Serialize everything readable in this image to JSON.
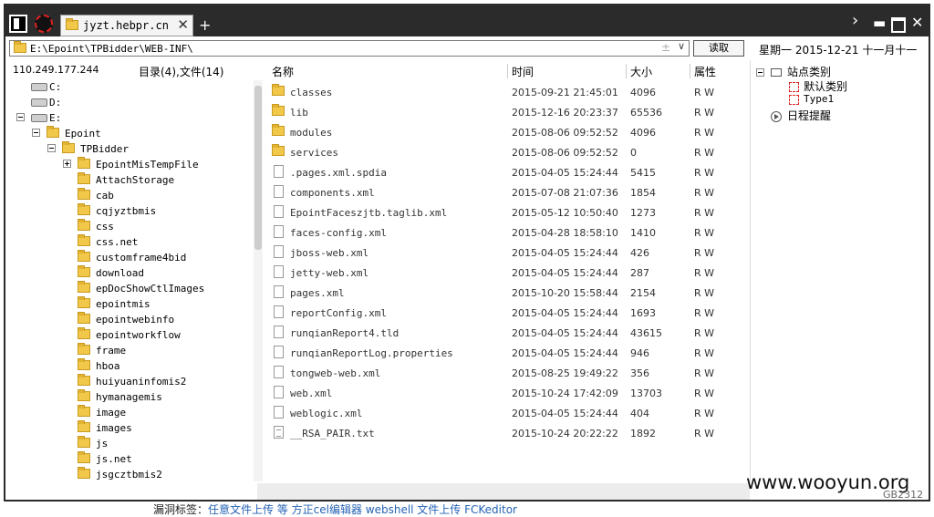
{
  "window": {
    "tab_title": "jyzt.hebpr.cn",
    "tab_close": "✕",
    "tab_add": "+",
    "nav_next": "›",
    "minimize": "▬",
    "close": "✕"
  },
  "address": {
    "path": "E:\\Epoint\\TPBidder\\WEB-INF\\",
    "clear": "±",
    "dropdown": "∨",
    "read_button": "读取"
  },
  "date_display": "星期一  2015-12-21  十一月十一",
  "left": {
    "ip": "110.249.177.244",
    "dir_count": "目录(4),文件(14)",
    "tree": [
      {
        "label": "C:",
        "type": "drive",
        "level": 0
      },
      {
        "label": "D:",
        "type": "drive",
        "level": 0
      },
      {
        "label": "E:",
        "type": "drive",
        "level": 0,
        "toggle": "minus"
      },
      {
        "label": "Epoint",
        "type": "folder",
        "level": 1,
        "toggle": "minus"
      },
      {
        "label": "TPBidder",
        "type": "folder",
        "level": 2,
        "toggle": "minus"
      },
      {
        "label": "EpointMisTempFile",
        "type": "folder",
        "level": 3,
        "toggle": "plus"
      },
      {
        "label": "AttachStorage",
        "type": "folder",
        "level": 3
      },
      {
        "label": "cab",
        "type": "folder",
        "level": 3
      },
      {
        "label": "cqjyztbmis",
        "type": "folder",
        "level": 3
      },
      {
        "label": "css",
        "type": "folder",
        "level": 3
      },
      {
        "label": "css.net",
        "type": "folder",
        "level": 3
      },
      {
        "label": "customframe4bid",
        "type": "folder",
        "level": 3
      },
      {
        "label": "download",
        "type": "folder",
        "level": 3
      },
      {
        "label": "epDocShowCtlImages",
        "type": "folder",
        "level": 3
      },
      {
        "label": "epointmis",
        "type": "folder",
        "level": 3
      },
      {
        "label": "epointwebinfo",
        "type": "folder",
        "level": 3
      },
      {
        "label": "epointworkflow",
        "type": "folder",
        "level": 3
      },
      {
        "label": "frame",
        "type": "folder",
        "level": 3
      },
      {
        "label": "hboa",
        "type": "folder",
        "level": 3
      },
      {
        "label": "huiyuaninfomis2",
        "type": "folder",
        "level": 3
      },
      {
        "label": "hymanagemis",
        "type": "folder",
        "level": 3
      },
      {
        "label": "image",
        "type": "folder",
        "level": 3
      },
      {
        "label": "images",
        "type": "folder",
        "level": 3
      },
      {
        "label": "js",
        "type": "folder",
        "level": 3
      },
      {
        "label": "js.net",
        "type": "folder",
        "level": 3
      },
      {
        "label": "jsgcztbmis2",
        "type": "folder",
        "level": 3
      }
    ]
  },
  "list": {
    "headers": {
      "name": "名称",
      "time": "时间",
      "size": "大小",
      "attr": "属性"
    },
    "rows": [
      {
        "name": "classes",
        "time": "2015-09-21 21:45:01",
        "size": "4096",
        "attr": "R W",
        "type": "folder"
      },
      {
        "name": "lib",
        "time": "2015-12-16 20:23:37",
        "size": "65536",
        "attr": "R W",
        "type": "folder"
      },
      {
        "name": "modules",
        "time": "2015-08-06 09:52:52",
        "size": "4096",
        "attr": "R W",
        "type": "folder"
      },
      {
        "name": "services",
        "time": "2015-08-06 09:52:52",
        "size": "0",
        "attr": "R W",
        "type": "folder"
      },
      {
        "name": ".pages.xml.spdia",
        "time": "2015-04-05 15:24:44",
        "size": "5415",
        "attr": "R W",
        "type": "file"
      },
      {
        "name": "components.xml",
        "time": "2015-07-08 21:07:36",
        "size": "1854",
        "attr": "R W",
        "type": "file"
      },
      {
        "name": "EpointFaceszjtb.taglib.xml",
        "time": "2015-05-12 10:50:40",
        "size": "1273",
        "attr": "R W",
        "type": "file"
      },
      {
        "name": "faces-config.xml",
        "time": "2015-04-28 18:58:10",
        "size": "1410",
        "attr": "R W",
        "type": "file"
      },
      {
        "name": "jboss-web.xml",
        "time": "2015-04-05 15:24:44",
        "size": "426",
        "attr": "R W",
        "type": "file"
      },
      {
        "name": "jetty-web.xml",
        "time": "2015-04-05 15:24:44",
        "size": "287",
        "attr": "R W",
        "type": "file"
      },
      {
        "name": "pages.xml",
        "time": "2015-10-20 15:58:44",
        "size": "2154",
        "attr": "R W",
        "type": "file"
      },
      {
        "name": "reportConfig.xml",
        "time": "2015-04-05 15:24:44",
        "size": "1693",
        "attr": "R W",
        "type": "file"
      },
      {
        "name": "runqianReport4.tld",
        "time": "2015-04-05 15:24:44",
        "size": "43615",
        "attr": "R W",
        "type": "file"
      },
      {
        "name": "runqianReportLog.properties",
        "time": "2015-04-05 15:24:44",
        "size": "946",
        "attr": "R W",
        "type": "file"
      },
      {
        "name": "tongweb-web.xml",
        "time": "2015-08-25 19:49:22",
        "size": "356",
        "attr": "R W",
        "type": "file"
      },
      {
        "name": "web.xml",
        "time": "2015-10-24 17:42:09",
        "size": "13703",
        "attr": "R W",
        "type": "file"
      },
      {
        "name": "weblogic.xml",
        "time": "2015-04-05 15:24:44",
        "size": "404",
        "attr": "R W",
        "type": "file"
      },
      {
        "name": "__RSA_PAIR.txt",
        "time": "2015-10-24 20:22:22",
        "size": "1892",
        "attr": "R W",
        "type": "txt"
      }
    ]
  },
  "right": {
    "site_category": "站点类别",
    "default_category": "默认类别",
    "type1": "Type1",
    "schedule": "日程提醒"
  },
  "watermark": "www.wooyun.org",
  "watermark_small": "GB2312",
  "bottom": {
    "prefix": "漏洞标签：",
    "links": "任意文件上传 等   方正cel编辑器 webshell 文件上传 FCKeditor"
  }
}
